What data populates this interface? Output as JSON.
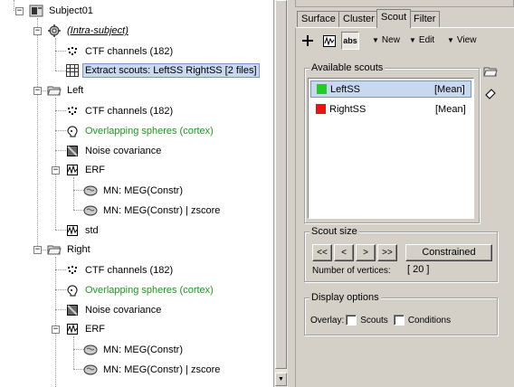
{
  "tree": {
    "subject": "Subject01",
    "intra_subject": "(Intra-subject)",
    "intra_children": [
      "CTF channels (182)",
      "Extract scouts: LeftSS RightSS [2 files]"
    ],
    "conditions": [
      {
        "name": "Left",
        "channels": "CTF channels (182)",
        "headmodel": "Overlapping spheres (cortex)",
        "noisecov": "Noise covariance",
        "erf": "ERF",
        "sources": [
          "MN: MEG(Constr)",
          "MN: MEG(Constr) | zscore"
        ],
        "std": "std"
      },
      {
        "name": "Right",
        "channels": "CTF channels (182)",
        "headmodel": "Overlapping spheres (cortex)",
        "noisecov": "Noise covariance",
        "erf": "ERF",
        "sources": [
          "MN: MEG(Constr)",
          "MN: MEG(Constr) | zscore"
        ]
      }
    ]
  },
  "tabs": [
    "Surface",
    "Cluster",
    "Scout",
    "Filter"
  ],
  "toolbar": {
    "abs_label": "abs",
    "new_label": "New",
    "edit_label": "Edit",
    "view_label": "View"
  },
  "available_scouts": {
    "title": "Available scouts",
    "items": [
      {
        "name": "LeftSS",
        "function": "[Mean]",
        "color": "#22cc22"
      },
      {
        "name": "RightSS",
        "function": "[Mean]",
        "color": "#ee1111"
      }
    ]
  },
  "scout_size": {
    "title": "Scout size",
    "buttons": [
      "<<",
      "<",
      ">",
      ">>"
    ],
    "constrained_label": "Constrained",
    "vertices_label": "Number of vertices:",
    "vertices_value": "[ 20 ]"
  },
  "display_options": {
    "title": "Display options",
    "overlay_label": "Overlay:",
    "scouts_label": "Scouts",
    "conditions_label": "Conditions"
  },
  "colors": {
    "selection": "#c8d8ee",
    "headmodel_text": "#1a9a1a"
  }
}
